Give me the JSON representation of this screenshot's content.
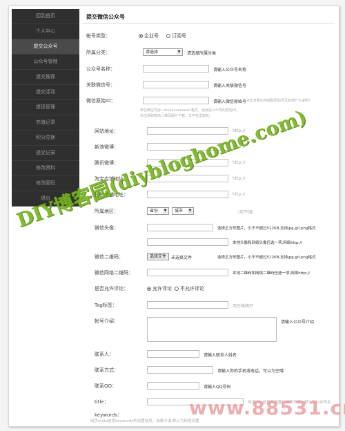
{
  "sidebar": {
    "items": [
      {
        "label": "回到首页"
      },
      {
        "label": "个人中心"
      },
      {
        "label": "提交公众号"
      },
      {
        "label": "公众号管理"
      },
      {
        "label": "提交推荐"
      },
      {
        "label": "提交活动"
      },
      {
        "label": "提现管理"
      },
      {
        "label": "充值记录"
      },
      {
        "label": "积分兑换"
      },
      {
        "label": "提交记录"
      },
      {
        "label": "修改资料"
      },
      {
        "label": "修改密码"
      },
      {
        "label": "退出"
      }
    ]
  },
  "page": {
    "title": "提交微信公众号"
  },
  "form": {
    "account_type": {
      "label": "帐号类型：",
      "opt1": "企业号",
      "opt2": "订阅号"
    },
    "category": {
      "label": "所属分类：",
      "selected": "请选择",
      "hint": "请选择所属分类"
    },
    "name": {
      "label": "公众号名称：",
      "hint": "请输入公众号名称"
    },
    "wechat_id": {
      "label": "关联微信号：",
      "hint": "请输入关联微信号"
    },
    "original_id": {
      "label": "微信原始ID：",
      "hint": "请输入微信原始号",
      "hint2": "点击查看如何获取原始号及其他什么说明？",
      "note1": "单位微信号gh_xxxxxxxxxxxxx 格式，也就是公众号的原始ID，",
      "note2": "点击获取微信二维码图片下载，文件名里面有。"
    },
    "website": {
      "label": "网站地址：",
      "hint": "http://"
    },
    "sina_weibo": {
      "label": "新浪微博：",
      "hint": "http://"
    },
    "tencent_weibo": {
      "label": "腾讯微博：",
      "hint": "http://"
    },
    "taobao": {
      "label": "淘宝店铺地址：",
      "hint": "http://"
    },
    "paipai": {
      "label": "拍拍店铺地址：",
      "hint": "http://"
    },
    "region": {
      "label": "所属地区：",
      "province": "省份",
      "city": "城市",
      "hint": "(可不填)"
    },
    "avatar": {
      "label": "微信头像：",
      "hint": "选择正方形图片，小于不超过512KB,支持jpg,gif,png格式"
    },
    "avatar_url": {
      "hint": "本地头像和网络头像任选一项,网络http://"
    },
    "qrcode": {
      "label": "微信二维码：",
      "btn": "选择文件",
      "file_status": "未选择文件",
      "hint": "选择正方形图片，小于不超过512KB,支持jpg,gif,png格式"
    },
    "qrcode_url": {
      "label": "微信网络二维码：",
      "hint": "本地二维码和网络二维码任选一项,网络http://"
    },
    "allow_comment": {
      "label": "是否允许评论：",
      "opt1": "允许评论",
      "opt2": "不允许评论"
    },
    "tags": {
      "label": "Tag标签：",
      "hint": "用空格隔开"
    },
    "intro": {
      "label": "帐号介绍：",
      "hint": "请输入公众号介绍"
    },
    "contact": {
      "label": "联系人：",
      "hint": "请输入联系人姓名"
    },
    "contact_method": {
      "label": "联系方式：",
      "hint": "请输入你的手机或电话，可以为空哦"
    },
    "qq": {
      "label": "联系QQ：",
      "hint": "请输入QQ号码"
    },
    "title": {
      "label": "title：",
      "hint": "网页title信息的设置，如果不填，默认为公众号名"
    },
    "keywords": {
      "label": "keywords：",
      "hint": "网页meta信息keywords的设置信息，如果不填,默认为标签设置"
    }
  },
  "watermark": {
    "text": "DIY博客园(diybloghome.com)",
    "number": "www.88531.cn",
    "color_green": "#78b520",
    "color_red": "#e89a9a"
  }
}
